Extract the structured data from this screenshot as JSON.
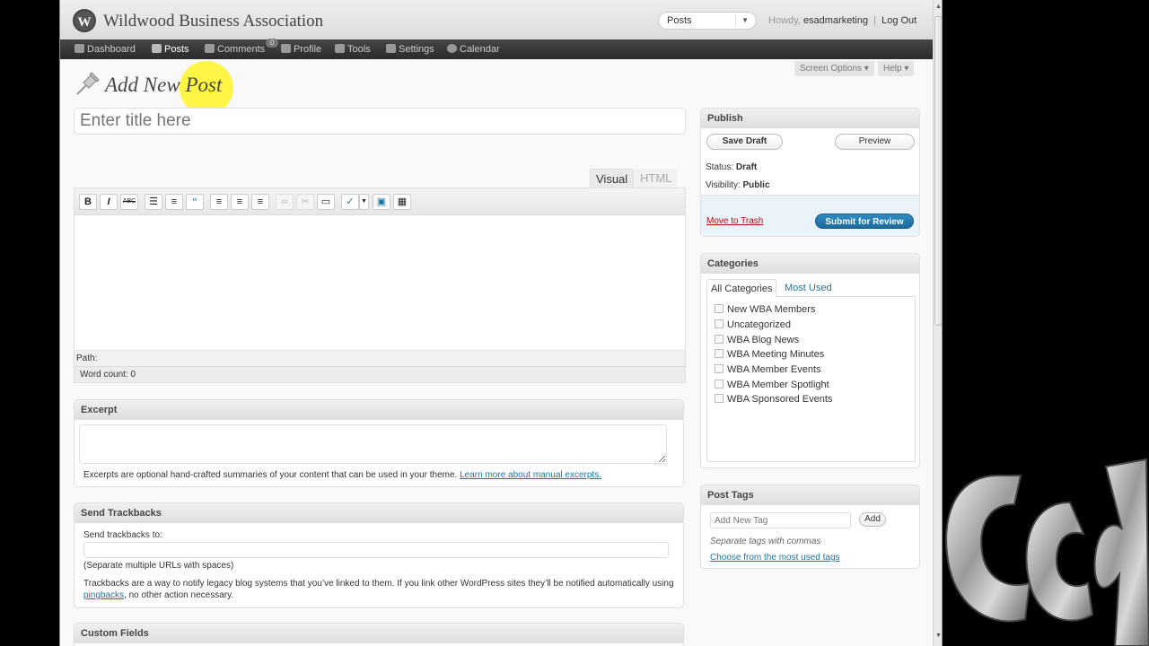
{
  "header": {
    "site_title": "Wildwood Business Association",
    "wp_logo_letter": "W",
    "favorites_select": "Posts",
    "howdy_prefix": "Howdy,",
    "username": "esadmarketing",
    "separator": "|",
    "logout": "Log Out"
  },
  "adminbar": {
    "items": [
      {
        "label": "Dashboard",
        "icon": "home-icon"
      },
      {
        "label": "Posts",
        "icon": "pushpin-icon"
      },
      {
        "label": "Comments",
        "icon": "speech-bubble-icon"
      },
      {
        "label": "Profile",
        "icon": "users-icon"
      },
      {
        "label": "Tools",
        "icon": "wrench-icon"
      },
      {
        "label": "Settings",
        "icon": "settings-icon"
      },
      {
        "label": "Calendar",
        "icon": "gear-icon"
      }
    ],
    "comment_count": "0"
  },
  "screen_options": "Screen Options",
  "help": "Help",
  "page": {
    "heading": "Add New Post",
    "title_placeholder": "Enter title here"
  },
  "editor": {
    "tab_visual": "Visual",
    "tab_html": "HTML",
    "toolbar": {
      "bold": "B",
      "italic": "I",
      "strike": "ABC",
      "blockquote": "“"
    },
    "path_label": "Path:",
    "word_count_label": "Word count:",
    "word_count_value": "0"
  },
  "excerpt": {
    "title": "Excerpt",
    "help_text": "Excerpts are optional hand-crafted summaries of your content that can be used in your theme.",
    "help_link": "Learn more about manual excerpts."
  },
  "trackbacks": {
    "title": "Send Trackbacks",
    "label": "Send trackbacks to:",
    "note": "(Separate multiple URLs with spaces)",
    "help_text_1": "Trackbacks are a way to notify legacy blog systems that you’ve linked to them. If you link other WordPress sites they’ll be notified automatically using",
    "help_link": "pingbacks",
    "help_text_2": ", no other action necessary."
  },
  "custom_fields": {
    "title": "Custom Fields"
  },
  "publish": {
    "title": "Publish",
    "save_draft": "Save Draft",
    "preview": "Preview",
    "status_label": "Status:",
    "status_value": "Draft",
    "visibility_label": "Visibility:",
    "visibility_value": "Public",
    "move_to_trash": "Move to Trash",
    "submit": "Submit for Review"
  },
  "categories": {
    "title": "Categories",
    "tab_all": "All Categories",
    "tab_most_used": "Most Used",
    "items": [
      "New WBA Members",
      "Uncategorized",
      "WBA Blog News",
      "WBA Meeting Minutes",
      "WBA Member Events",
      "WBA Member Spotlight",
      "WBA Sponsored Events"
    ]
  },
  "tags": {
    "title": "Post Tags",
    "input_placeholder": "Add New Tag",
    "add_button": "Add",
    "note": "Separate tags with commas",
    "choose_link": "Choose from the most used tags"
  },
  "colors": {
    "accent_blue": "#21759b",
    "submit_blue": "#2e8cc4",
    "trash_red": "#bc0b0b",
    "highlight_yellow": "#fff528"
  }
}
